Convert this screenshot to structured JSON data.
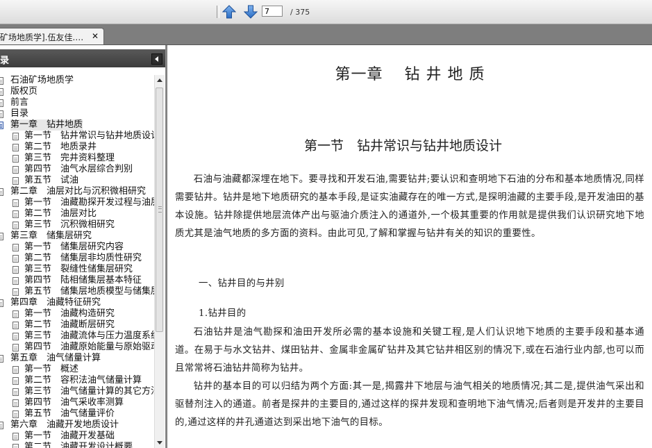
{
  "toolbar": {
    "current_page": "7",
    "total_pages": "/ 375",
    "prev_icon": "arrow-up-icon",
    "next_icon": "arrow-down-icon"
  },
  "tab": {
    "title": "矿场地质学].伍友佳.…",
    "close_label": "✕"
  },
  "sidebar": {
    "title": "录",
    "items": [
      {
        "label": "石油矿场地质学",
        "level": 0
      },
      {
        "label": "版权页",
        "level": 0
      },
      {
        "label": "前言",
        "level": 0
      },
      {
        "label": "目录",
        "level": 0
      },
      {
        "label": "第一章　钻井地质",
        "level": 0,
        "selected": true
      },
      {
        "label": "第一节　钻井常识与钻井地质设计",
        "level": 1
      },
      {
        "label": "第二节　地质录井",
        "level": 1
      },
      {
        "label": "第三节　完井资料整理",
        "level": 1
      },
      {
        "label": "第四节　油气水层综合判别",
        "level": 1
      },
      {
        "label": "第五节　试油",
        "level": 1
      },
      {
        "label": "第二章　油层对比与沉积微相研究",
        "level": 0
      },
      {
        "label": "第一节　油藏勘探开发过程与油层对比",
        "level": 1
      },
      {
        "label": "第二节　油层对比",
        "level": 1
      },
      {
        "label": "第三节　沉积微相研究",
        "level": 1
      },
      {
        "label": "第三章　储集层研究",
        "level": 0
      },
      {
        "label": "第一节　储集层研究内容",
        "level": 1
      },
      {
        "label": "第二节　储集层非均质性研究",
        "level": 1
      },
      {
        "label": "第三节　裂缝性储集层研究",
        "level": 1
      },
      {
        "label": "第四节　陆相储集层基本特征",
        "level": 1
      },
      {
        "label": "第五节　储集层地质模型与储集层评价",
        "level": 1
      },
      {
        "label": "第四章　油藏特征研究",
        "level": 0
      },
      {
        "label": "第一节　油藏构造研究",
        "level": 1
      },
      {
        "label": "第二节　油藏断层研究",
        "level": 1
      },
      {
        "label": "第三节　油藏流体与压力温度系统",
        "level": 1
      },
      {
        "label": "第四节　油藏原始能量与原始驱动类型",
        "level": 1
      },
      {
        "label": "第五章　油气储量计算",
        "level": 0
      },
      {
        "label": "第一节　概述",
        "level": 1
      },
      {
        "label": "第二节　容积法油气储量计算",
        "level": 1
      },
      {
        "label": "第三节　油气储量计算的其它方法",
        "level": 1
      },
      {
        "label": "第四节　油气采收率测算",
        "level": 1
      },
      {
        "label": "第五节　油气储量评价",
        "level": 1
      },
      {
        "label": "第六章　油藏开发地质设计",
        "level": 0
      },
      {
        "label": "第一节　油藏开发基础",
        "level": 1
      },
      {
        "label": "第二节　油藏开发设计概要",
        "level": 1
      }
    ]
  },
  "document": {
    "chapter_title": "第一章　 钻 井 地 质",
    "section_title": "第一节　钻井常识与钻井地质设计",
    "para1": "石油与油藏都深埋在地下。要寻找和开发石油,需要钻井;要认识和查明地下石油的分布和基本地质情况,同样需要钻井。钻井是地下地质研究的基本手段,是证实油藏存在的唯一方式,是探明油藏的主要手段,是开发油田的基本设施。钻井除提供地层流体产出与驱油介质注入的通道外,一个极其重要的作用就是提供我们认识研究地下地质尤其是油气地质的多方面的资料。由此可见,了解和掌握与钻井有关的知识的重要性。",
    "heading1": "一、钻井目的与井别",
    "heading2": "1.钻井目的",
    "para2": "石油钻井是油气勘探和油田开发所必需的基本设施和关键工程,是人们认识地下地质的主要手段和基本通道。在易于与水文钻井、煤田钻井、金属非金属矿钻井及其它钻井相区别的情况下,或在石油行业内部,也可以而且常常将石油钻井简称为钻井。",
    "para3": "钻井的基本目的可以归结为两个方面:其一是,揭露井下地层与油气相关的地质情况;其二是,提供油气采出和驱替剂注入的通道。前者是探井的主要目的,通过这样的探井发现和查明地下油气情况;后者则是开发井的主要目的,通过这样的井孔通道达到采出地下油气的目标。"
  }
}
